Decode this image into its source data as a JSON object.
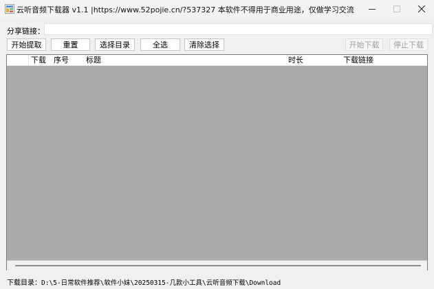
{
  "window": {
    "title": "云听音频下载器 v1.1 |https://www.52pojie.cn/?537327 本软件不得用于商业用途，仅做学习交流",
    "icon": "app-icon",
    "controls": {
      "minimize": "minimize-icon",
      "maximize": "maximize-icon",
      "close": "close-icon"
    }
  },
  "share": {
    "label": "分享链接：",
    "value": ""
  },
  "toolbar": {
    "fetch_label": "开始提取",
    "reset_label": "重置",
    "choose_dir_label": "选择目录",
    "select_all_label": "全选",
    "clear_selection_label": "清除选择",
    "start_download_label": "开始下载",
    "stop_download_label": "停止下载"
  },
  "list": {
    "columns": {
      "download": "下载",
      "index": "序号",
      "title": "标题",
      "duration": "时长",
      "link": "下载链接"
    },
    "rows": []
  },
  "status": {
    "label": "下载目录：",
    "path": "D:\\5-日常软件推荐\\软件小妹\\20250315-几款小工具\\云听音频下载\\Download"
  },
  "colors": {
    "window_bg": "#f0f0f0",
    "list_bg": "#ababab",
    "disabled_text": "#a0a0a0"
  }
}
